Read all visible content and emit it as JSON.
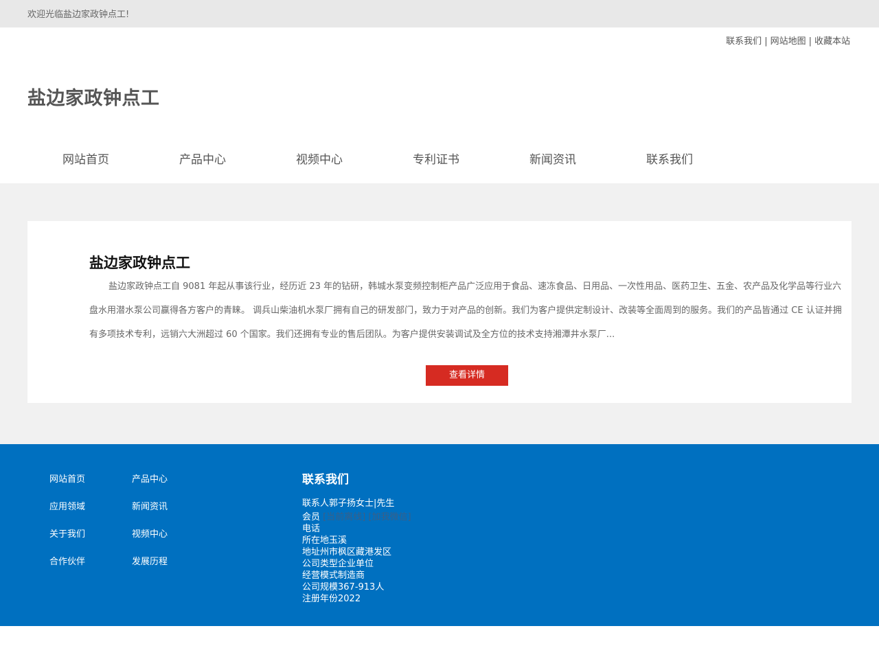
{
  "topbar": {
    "welcome": "欢迎光临盐边家政钟点工!"
  },
  "header_links": [
    "联系我们",
    "网站地图",
    "收藏本站"
  ],
  "header_link_separator": "|",
  "logo": "盐边家政钟点工",
  "nav": [
    "网站首页",
    "产品中心",
    "视频中心",
    "专利证书",
    "新闻资讯",
    "联系我们"
  ],
  "intro": {
    "title": "盐边家政钟点工",
    "text": "盐边家政钟点工自 9081 年起从事该行业，经历近 23 年的钻研，韩城水泵变频控制柜产品广泛应用于食品、速冻食品、日用品、一次性用品、医药卫生、五金、农产品及化学品等行业六盘水用潜水泵公司赢得各方客户的青睐。 调兵山柴油机水泵厂拥有自己的研发部门，致力于对产品的创新。我们为客户提供定制设计、改装等全面周到的服务。我们的产品皆通过 CE 认证并拥有多项技术专利，远销六大洲超过 60 个国家。我们还拥有专业的售后团队。为客户提供安装调试及全方位的技术支持湘潭井水泵厂...",
    "button": "查看详情"
  },
  "footer": {
    "links_col1": [
      "网站首页",
      "应用领域",
      "关于我们",
      "合作伙伴"
    ],
    "links_col2": [
      "产品中心",
      "新闻资讯",
      "视频中心",
      "发展历程"
    ],
    "contact_title": "联系我们",
    "contact_person": "联系人郭子扬女士|先生",
    "member_label": "会员",
    "member_value": "[当前离线] [加我微信]",
    "info_rows": [
      "电话",
      "所在地玉溪",
      "地址州市枫区藏港发区",
      "公司类型企业单位",
      "经营模式制造商",
      "公司规模367-913人",
      "注册年份2022"
    ]
  },
  "colors": {
    "footer_bg": "#0070c0",
    "button_bg": "#d62b22",
    "topbar_bg": "#e8e8e8",
    "band_bg": "#f1f1f1"
  }
}
